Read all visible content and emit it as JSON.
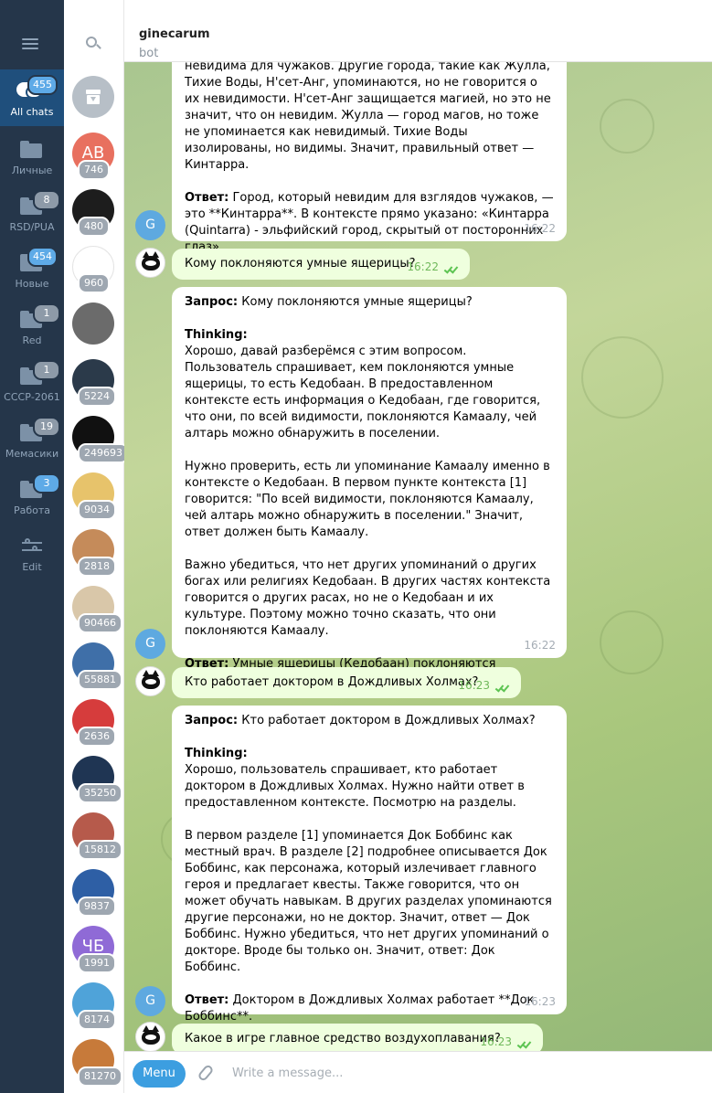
{
  "folders": {
    "items": [
      {
        "label": "All chats",
        "badge": "455",
        "icon": "chats-icon",
        "active": true
      },
      {
        "label": "Личные",
        "badge": "",
        "icon": "folder-icon"
      },
      {
        "label": "RSD/PUA",
        "badge": "8",
        "icon": "folder-icon"
      },
      {
        "label": "Новые",
        "badge": "454",
        "icon": "folder-icon"
      },
      {
        "label": "Red",
        "badge": "1",
        "icon": "folder-icon"
      },
      {
        "label": "СССР-2061",
        "badge": "1",
        "icon": "folder-icon"
      },
      {
        "label": "Мемасики",
        "badge": "19",
        "icon": "folder-icon"
      },
      {
        "label": "Работа",
        "badge": "3",
        "icon": "folder-icon"
      },
      {
        "label": "Edit",
        "badge": "",
        "icon": "edit-icon"
      }
    ]
  },
  "chatlist": {
    "chats": [
      {
        "initials": "",
        "badge": "",
        "color": "#b7bfc7",
        "icon": "archive-icon"
      },
      {
        "initials": "AB",
        "badge": "746",
        "color": "#e8705f"
      },
      {
        "initials": "",
        "badge": "480",
        "color": "#1d1d1d"
      },
      {
        "initials": "",
        "badge": "960",
        "color": "#ffffff"
      },
      {
        "initials": "",
        "badge": "",
        "color": "#6b6b6b"
      },
      {
        "initials": "",
        "badge": "5224",
        "color": "#2b3a4a"
      },
      {
        "initials": "",
        "badge": "249693",
        "color": "#111111"
      },
      {
        "initials": "",
        "badge": "9034",
        "color": "#e7c36b"
      },
      {
        "initials": "",
        "badge": "2818",
        "color": "#c58b5a"
      },
      {
        "initials": "",
        "badge": "90466",
        "color": "#d9c7a9"
      },
      {
        "initials": "",
        "badge": "55881",
        "color": "#3f6fa8"
      },
      {
        "initials": "",
        "badge": "2636",
        "color": "#d63c3c"
      },
      {
        "initials": "",
        "badge": "35250",
        "color": "#1f3553"
      },
      {
        "initials": "",
        "badge": "15812",
        "color": "#b65a4b"
      },
      {
        "initials": "",
        "badge": "9837",
        "color": "#2e5fa5"
      },
      {
        "initials": "ЧБ",
        "badge": "1991",
        "color": "#8f6ad6"
      },
      {
        "initials": "",
        "badge": "8174",
        "color": "#4fa3d9"
      },
      {
        "initials": "",
        "badge": "81270",
        "color": "#c77a3a"
      }
    ]
  },
  "header": {
    "title": "ginecarum",
    "subtitle": "bot"
  },
  "bot_initial": "G",
  "messages": [
    {
      "type": "in",
      "text_top": "невидима для чужаков. Другие города, такие как Жулла, Тихие Воды, Н'сет-Анг, упоминаются, но не говорится о их невидимости. Н'сет-Анг защищается магией, но это не значит, что он невидим. Жулла — город магов, но тоже не упоминается как невидимый. Тихие Воды изолированы, но видимы. Значит, правильный ответ — Кинтарра.",
      "answer_label": "Ответ:",
      "answer_text": " Город, который невидим для взглядов чужаков, — это **Кинтарра**. В контексте прямо указано: «Кинтарра (Quintarra) - эльфийский город, скрытый от посторонних глаз».",
      "time": "16:22"
    },
    {
      "type": "out",
      "text": "Кому поклоняются умные ящерицы?",
      "time": "16:22"
    },
    {
      "type": "in",
      "query_label": "Запрос:",
      "query_text": " Кому поклоняются умные ящерицы?",
      "thinking_label": "Thinking:",
      "thinking": "Хорошо, давай разберёмся с этим вопросом. Пользователь спрашивает, кем поклоняются умные ящерицы, то есть Кедобаан. В предоставленном контексте есть информация о Кедобаан, где говорится, что они, по всей видимости, поклоняются Камаалу, чей алтарь можно обнаружить в поселении.\n\nНужно проверить, есть ли упоминание Камаалу именно в контексте о Кедобаан. В первом пункте контекста [1] говорится: \"По всей видимости, поклоняются Камаалу, чей алтарь можно обнаружить в поселении.\" Значит, ответ должен быть Камаалу.\n\nВажно убедиться, что нет других упоминаний о других богах или религиях Кедобаан. В других частях контекста говорится о других расах, но не о Кедобаан и их культуре. Поэтому можно точно сказать, что они поклоняются Камаалу.",
      "answer_label": "Ответ:",
      "answer_text": " Умные ящерицы (Кедобаан) поклоняются Камаалу.",
      "time": "16:22"
    },
    {
      "type": "out",
      "text": "Кто работает доктором в Дождливых Холмах?",
      "time": "16:23"
    },
    {
      "type": "in",
      "query_label": "Запрос:",
      "query_text": " Кто работает доктором в Дождливых Холмах?",
      "thinking_label": "Thinking:",
      "thinking": "Хорошо, пользователь спрашивает, кто работает доктором в Дождливых Холмах. Нужно найти ответ в предоставленном контексте. Посмотрю на разделы.\n\nВ первом разделе [1] упоминается Док Боббинс как местный врач. В разделе [2] подробнее описывается Док Боббинс, как персонажа, который излечивает главного героя и предлагает квесты. Также говорится, что он может обучать навыкам. В других разделах упоминаются другие персонажи, но не доктор. Значит, ответ — Док Боббинс. Нужно убедиться, что нет других упоминаний о докторе. Вроде бы только он. Значит, ответ: Док Боббинс.",
      "answer_label": "Ответ:",
      "answer_text": " Доктором в Дождливых Холмах работает **Док Боббинс**.",
      "time": "16:23"
    },
    {
      "type": "out",
      "text": "Какое в игре главное средство воздухоплавания?",
      "time": "16:23"
    }
  ],
  "composer": {
    "menu_label": "Menu",
    "placeholder": "Write a message..."
  },
  "colors": {
    "sidebar": "#25364a",
    "active_folder": "#1f4f7c",
    "accent": "#3c9ee0",
    "outgoing": "#efffde",
    "check": "#5dc452"
  }
}
